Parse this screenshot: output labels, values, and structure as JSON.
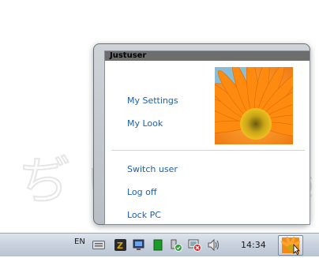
{
  "popup": {
    "username": "Justuser",
    "menu_items": [
      {
        "label": "My Settings"
      },
      {
        "label": "My Look"
      },
      {
        "label": "Switch user"
      },
      {
        "label": "Log off"
      },
      {
        "label": "Lock PC"
      }
    ],
    "avatar_icon": "orange-gerbera-flower"
  },
  "taskbar": {
    "language": "EN",
    "clock": "14:34",
    "tray_icons": [
      "keyboard-icon",
      "winamp-z-icon",
      "network-monitor-icon",
      "green-app-icon",
      "safely-remove-hardware-icon",
      "action-center-flag-icon",
      "volume-icon"
    ],
    "user_button_icon": "flower-icon"
  },
  "colors": {
    "link": "#1c5fb0",
    "header_bar": "#6d6d6d",
    "taskbar_top": "#dfe5ed",
    "taskbar_bottom": "#bac5d3"
  }
}
